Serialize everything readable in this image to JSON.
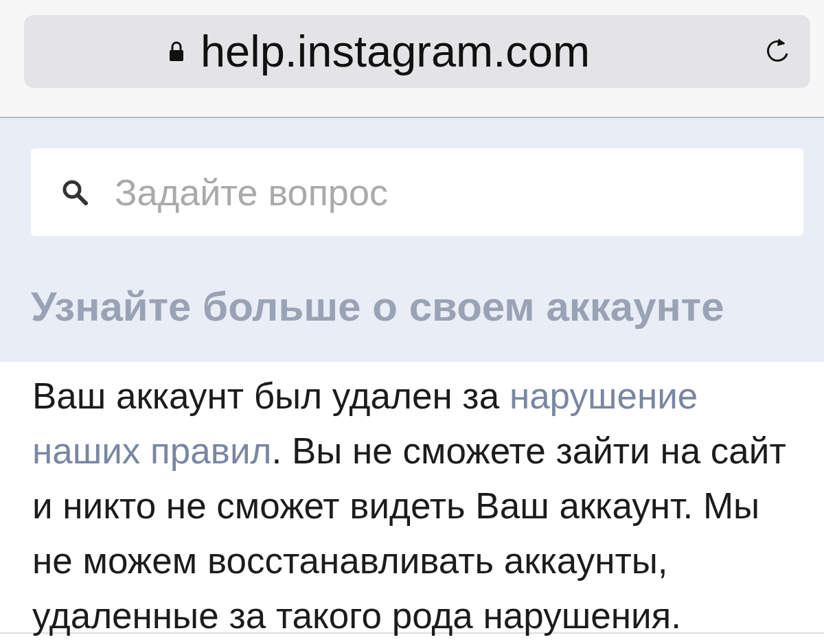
{
  "address_bar": {
    "url": "help.instagram.com"
  },
  "search": {
    "placeholder": "Задайте вопрос"
  },
  "heading": "Узнайте больше о своем аккаунте",
  "message": [
    {
      "kind": "text",
      "text": "Ваш аккаунт был удален за "
    },
    {
      "kind": "link",
      "text": "нарушение "
    },
    {
      "kind": "link",
      "text": "наших правил"
    },
    {
      "kind": "text",
      "text": ". Вы не сможете зайти на сайт и никто не сможет видеть Ваш аккаунт. Мы не можем восстанавливать аккаунты, удаленные за такого рода нарушения."
    }
  ]
}
